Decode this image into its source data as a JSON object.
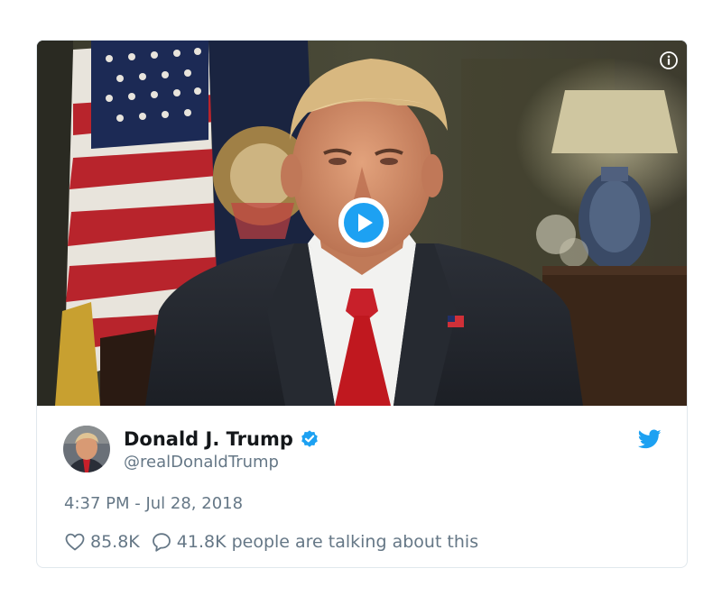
{
  "tweet": {
    "author": {
      "display_name": "Donald J. Trump",
      "handle": "@realDonaldTrump",
      "verified": true
    },
    "timestamp": "4:37 PM - Jul 28, 2018",
    "likes": "85.8K",
    "replies_text": "41.8K people are talking about this"
  },
  "icons": {
    "info": "info-icon",
    "play": "play-icon",
    "verified": "verified-badge-icon",
    "brand": "twitter-bird-icon",
    "like": "heart-icon",
    "reply": "speech-bubble-icon"
  },
  "colors": {
    "brand_blue": "#1da1f2",
    "secondary_text": "#657786",
    "primary_text": "#14171a",
    "border": "#e1e8ed"
  }
}
